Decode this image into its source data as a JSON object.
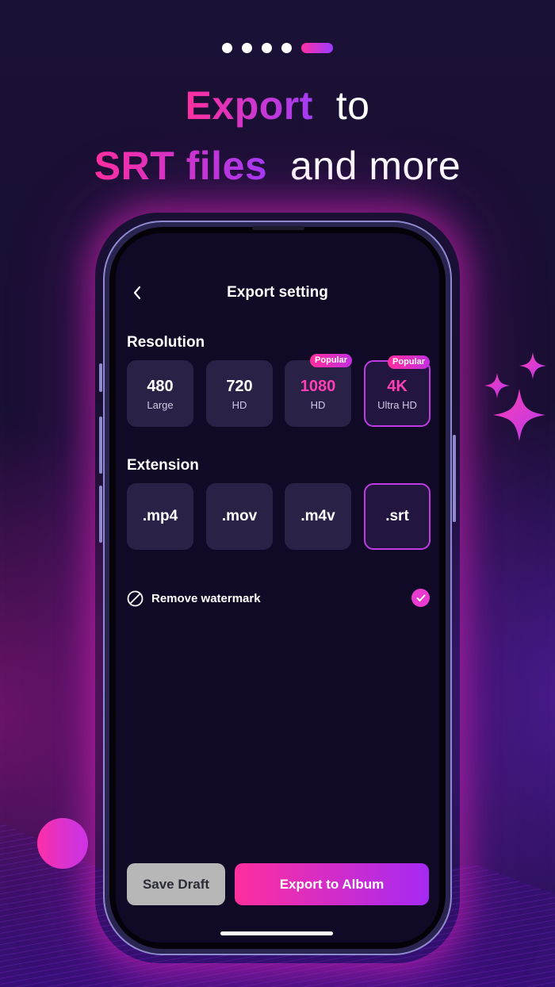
{
  "pagination": {
    "total": 5,
    "active_index": 4
  },
  "headline": {
    "line1_highlight": "Export",
    "line1_rest": "to",
    "line2_highlight": "SRT files",
    "line2_rest": "and more"
  },
  "screen": {
    "title": "Export setting",
    "back_icon": "chevron-left-icon",
    "resolution": {
      "label": "Resolution",
      "options": [
        {
          "value": "480",
          "sub": "Large",
          "badge": "",
          "selected": false
        },
        {
          "value": "720",
          "sub": "HD",
          "badge": "",
          "selected": false
        },
        {
          "value": "1080",
          "sub": "HD",
          "badge": "Popular",
          "selected": false
        },
        {
          "value": "4K",
          "sub": "Ultra HD",
          "badge": "Popular",
          "selected": true
        }
      ]
    },
    "extension": {
      "label": "Extension",
      "options": [
        {
          "value": ".mp4",
          "selected": false
        },
        {
          "value": ".mov",
          "selected": false
        },
        {
          "value": ".m4v",
          "selected": false
        },
        {
          "value": ".srt",
          "selected": true
        }
      ]
    },
    "watermark": {
      "label": "Remove watermark",
      "checked": true,
      "icon": "no-symbol-icon"
    },
    "buttons": {
      "save_draft": "Save Draft",
      "export": "Export to Album"
    }
  },
  "colors": {
    "accent_pink": "#ff2f9e",
    "accent_purple": "#a52af3",
    "background": "#1a0f33",
    "tile": "#2a2147"
  }
}
